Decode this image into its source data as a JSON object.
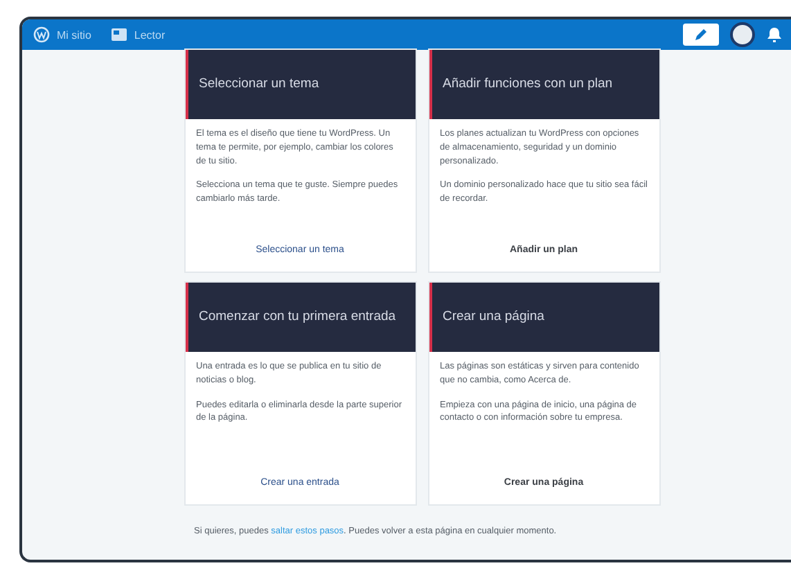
{
  "top_bar": {
    "site": "Mi sitio",
    "reader": "Lector"
  },
  "cards": [
    {
      "title": "Seleccionar un tema",
      "paragraphs": [
        "El tema es el diseño que tiene tu WordPress. Un tema te permite, por ejemplo, cambiar los colores de tu sitio.",
        "Selecciona un tema que te guste. Siempre puedes cambiarlo más tarde."
      ],
      "action": "Seleccionar un tema",
      "action_bold": false
    },
    {
      "title": "Añadir funciones con un plan",
      "paragraphs": [
        "Los planes actualizan tu WordPress con opciones de almacenamiento, seguridad y un dominio personalizado.",
        "Un dominio personalizado hace que tu sitio sea fácil de recordar."
      ],
      "action": "Añadir un plan",
      "action_bold": true
    },
    {
      "title": "Comenzar con tu primera entrada",
      "paragraphs": [
        "Una entrada es lo que se publica en tu sitio de noticias o blog.",
        "Puedes editarla o eliminarla desde la parte superior de la página."
      ],
      "action": "Crear una entrada",
      "action_bold": false
    },
    {
      "title": "Crear una página",
      "paragraphs": [
        "Las páginas son estáticas y sirven para contenido que no cambia, como Acerca de.",
        "Empieza con una página de inicio, una página de contacto o con información sobre tu empresa."
      ],
      "action": "Crear una página",
      "action_bold": true
    }
  ],
  "footer": {
    "before": "Si quieres, puedes",
    "link": "saltar estos pasos",
    "after": ". Puedes volver a esta página en cualquier momento."
  }
}
